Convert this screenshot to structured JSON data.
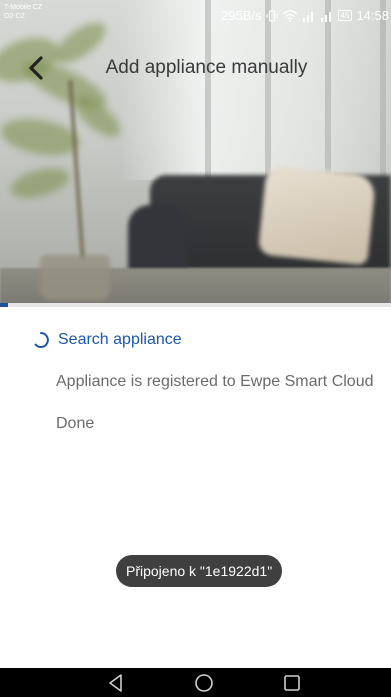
{
  "status_bar": {
    "carrier_line1": "T-Mobile CZ",
    "carrier_line2": "O2-CZ",
    "data_rate": "295B/s",
    "battery": "45",
    "time": "14:58"
  },
  "header": {
    "title": "Add appliance manually"
  },
  "progress": {
    "fraction": 0.02
  },
  "steps": [
    {
      "label": "Search appliance",
      "state": "in-progress"
    },
    {
      "label": "Appliance is registered to Ewpe Smart Cloud",
      "state": "pending"
    },
    {
      "label": "Done",
      "state": "pending"
    }
  ],
  "toast": {
    "text": "Připojeno k \"1e1922d1\""
  },
  "colors": {
    "accent": "#1b56b0",
    "progress": "#1f4f9f",
    "muted_text": "#6b6b6b",
    "toast_bg": "#3f3f3f",
    "navbar_bg": "#000000"
  },
  "icons": {
    "back": "chevron-left-icon",
    "spinner": "loading-spinner-icon",
    "nav_back": "triangle-back-icon",
    "nav_home": "circle-home-icon",
    "nav_recent": "square-recent-icon"
  }
}
